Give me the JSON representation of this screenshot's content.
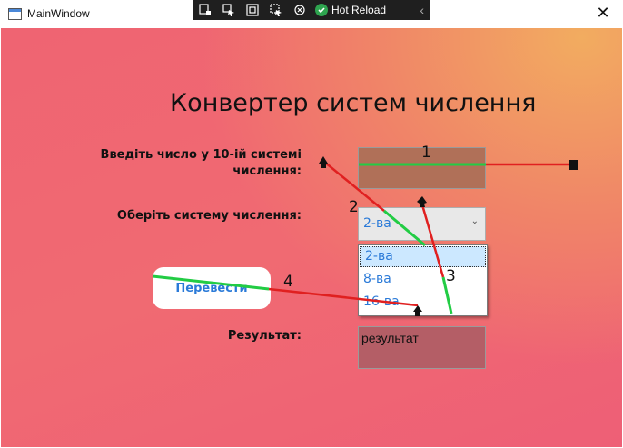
{
  "window": {
    "title": "MainWindow",
    "close_glyph": "✕"
  },
  "debug_toolbar": {
    "hot_reload_label": "Hot Reload",
    "collapse_glyph": "‹"
  },
  "heading": "Конвертер систем числення",
  "labels": {
    "input_line1": "Введіть число у 10-ій системі",
    "input_line2": "числення:",
    "base": "Оберіть систему числення:",
    "result": "Результат:"
  },
  "input_value": "",
  "combo": {
    "selected": "2-ва",
    "arrow_glyph": "⌄"
  },
  "dropdown_options": [
    "2-ва",
    "8-ва",
    "16-ва"
  ],
  "convert_button": "Перевести",
  "result_value": "результат",
  "annotation_numbers": [
    "1",
    "2",
    "3",
    "4"
  ],
  "colors": {
    "accent_text": "#2a7ad8",
    "annotation_red": "#e02020",
    "annotation_green": "#22cc44"
  }
}
